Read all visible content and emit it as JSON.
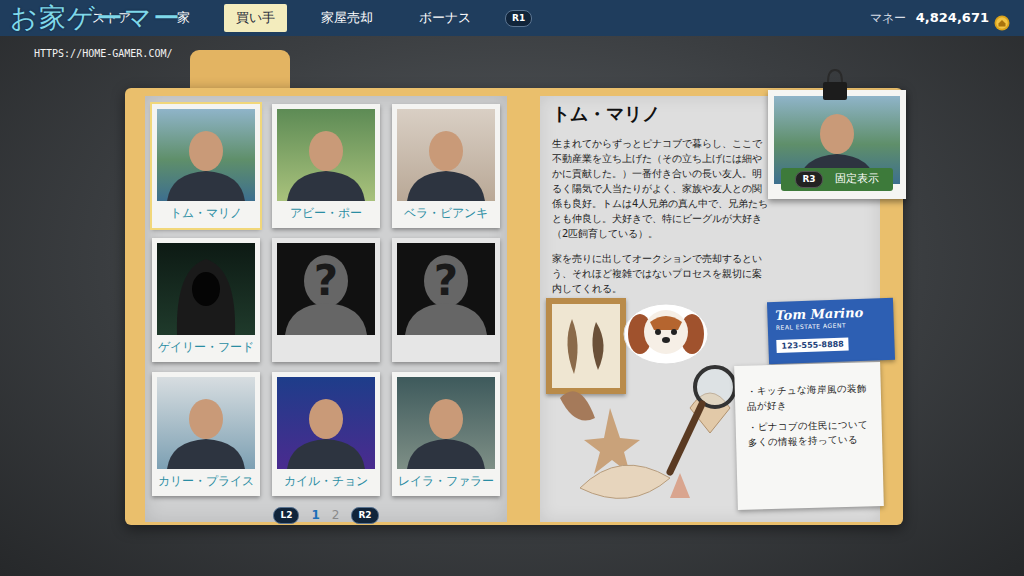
{
  "watermark": {
    "logo": "お家ゲーマー",
    "url": "HTTPS://HOME-GAMER.COM/"
  },
  "tabs": [
    {
      "label": "ストア",
      "selected": false
    },
    {
      "label": "家",
      "selected": false
    },
    {
      "label": "買い手",
      "selected": true
    },
    {
      "label": "家屋売却",
      "selected": false
    },
    {
      "label": "ボーナス",
      "selected": false
    }
  ],
  "tab_next_key": "R1",
  "money": {
    "label": "マネー",
    "value": "4,824,671"
  },
  "characters": [
    {
      "name": "トム・マリノ",
      "unlocked": true,
      "selected": true
    },
    {
      "name": "アビー・ポー",
      "unlocked": true,
      "selected": false
    },
    {
      "name": "ベラ・ビアンキ",
      "unlocked": true,
      "selected": false
    },
    {
      "name": "ゲイリー・フード",
      "unlocked": true,
      "selected": false
    },
    {
      "mark": "?",
      "unlocked": false,
      "selected": false
    },
    {
      "mark": "?",
      "unlocked": false,
      "selected": false
    },
    {
      "name": "カリー・プライス",
      "unlocked": true,
      "selected": false
    },
    {
      "name": "カイル・チョン",
      "unlocked": true,
      "selected": false
    },
    {
      "name": "レイラ・ファラー",
      "unlocked": true,
      "selected": false
    }
  ],
  "pagination": {
    "prev_key": "L2",
    "pages": [
      {
        "label": "1",
        "selected": true
      },
      {
        "label": "2",
        "selected": false
      }
    ],
    "next_key": "R2"
  },
  "detail": {
    "name": "トム・マリノ",
    "paragraphs": [
      "生まれてからずっとピナコブで暮らし、ここで不動産業を立ち上げた（その立ち上げには細やかに貢献した。）一番付き合いの長い友人。明るく陽気で人当たりがよく、家族や友人との関係も良好。トムは4人兄弟の真ん中で、兄弟たちとも仲良し。犬好きで、特にビーグルが大好き（2匹飼育している）。",
      "家を売りに出してオークションで売却するという、それほど複雑ではないプロセスを親切に案内してくれる。"
    ],
    "pin": {
      "key": "R3",
      "label": "固定表示"
    },
    "card": {
      "name": "Tom Marino",
      "title": "REAL ESTATE AGENT",
      "phone": "123-555-8888"
    },
    "notes": [
      "・キッチュな海岸風の装飾品が好き",
      "・ピナコブの住民について多くの情報を持っている"
    ]
  }
}
